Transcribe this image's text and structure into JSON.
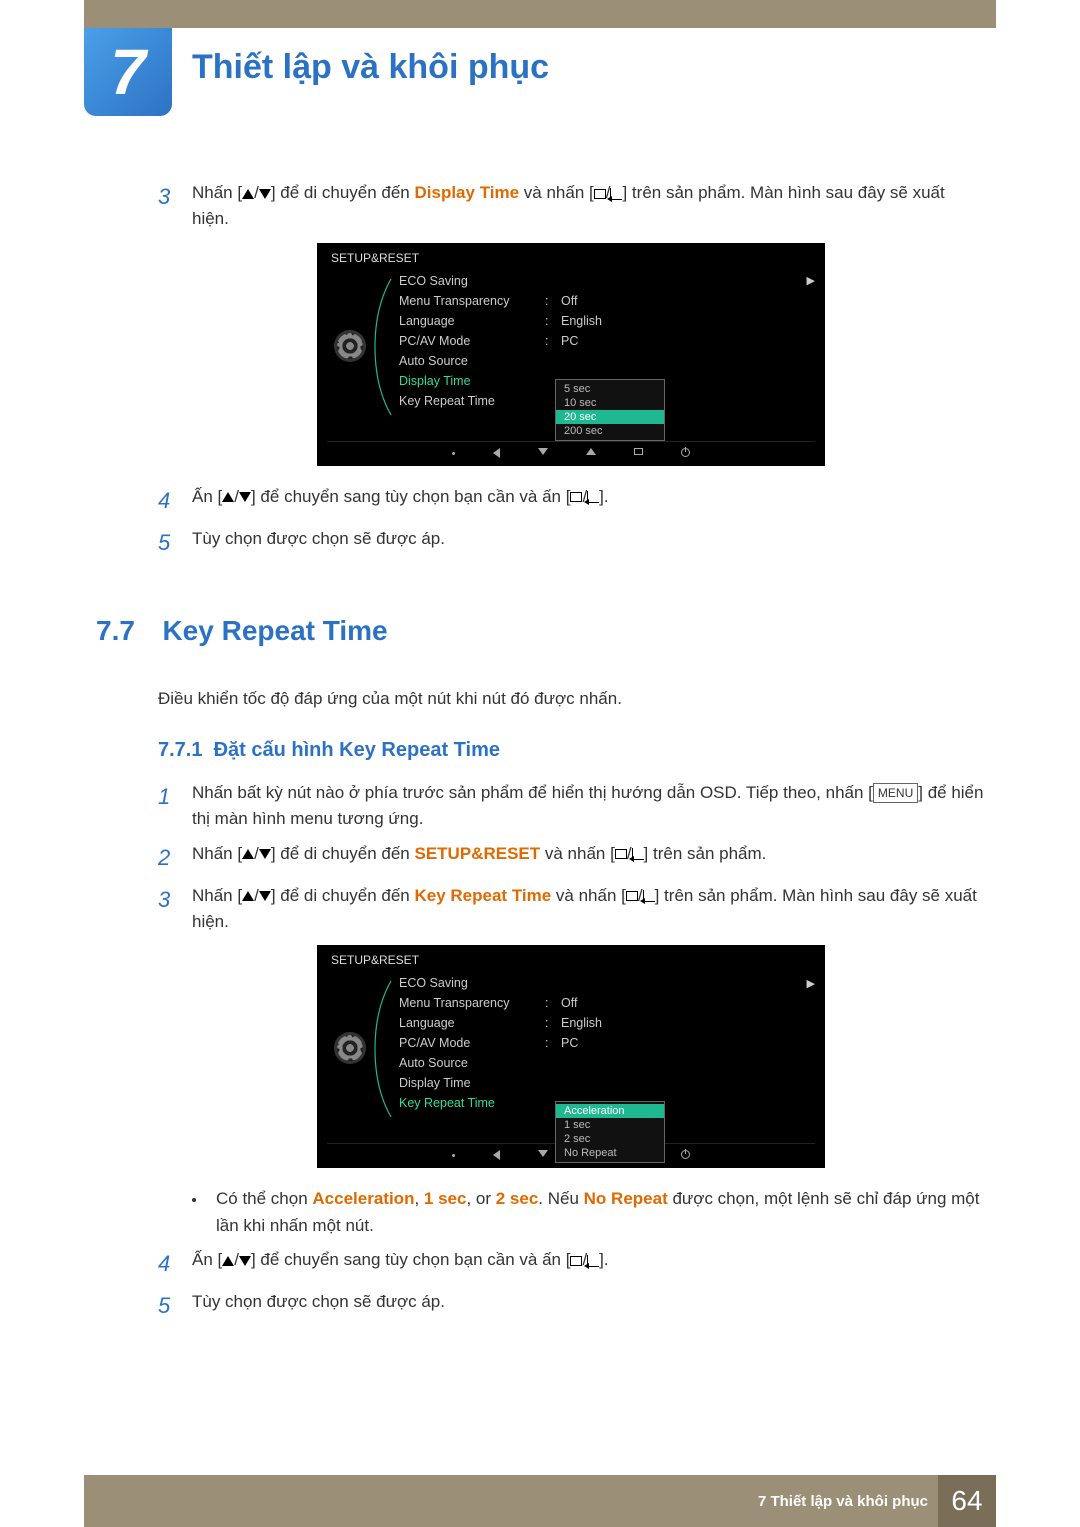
{
  "chapter": {
    "number": "7",
    "title": "Thiết lập và khôi phục"
  },
  "step3": {
    "num": "3",
    "pre": "Nhấn [",
    "mid1": "] để di chuyển đến ",
    "highlight": "Display Time",
    "mid2": " và nhấn [",
    "post": "] trên sản phẩm. Màn hình sau đây sẽ xuất hiện."
  },
  "osd1": {
    "title": "SETUP&RESET",
    "items": [
      {
        "label": "ECO Saving",
        "val": ""
      },
      {
        "label": "Menu Transparency",
        "val": "Off"
      },
      {
        "label": "Language",
        "val": "English"
      },
      {
        "label": "PC/AV Mode",
        "val": "PC"
      },
      {
        "label": "Auto Source",
        "val": ""
      },
      {
        "label": "Display Time",
        "val": "",
        "active": true
      },
      {
        "label": "Key Repeat Time",
        "val": ""
      }
    ],
    "popup": {
      "at": 5,
      "options": [
        {
          "t": "5 sec"
        },
        {
          "t": "10 sec"
        },
        {
          "t": "20 sec",
          "sel": true
        },
        {
          "t": "200 sec"
        }
      ]
    }
  },
  "step4": {
    "num": "4",
    "pre": "Ấn [",
    "mid": "] để chuyển sang tùy chọn bạn cần và ấn [",
    "post": "]."
  },
  "step5": {
    "num": "5",
    "text": "Tùy chọn được chọn sẽ được áp."
  },
  "section77": {
    "num": "7.7",
    "title": "Key Repeat Time",
    "desc": "Điều khiển tốc độ đáp ứng của một nút khi nút đó được nhấn.",
    "sub_num": "7.7.1",
    "sub_title": "Đặt cấu hình Key Repeat Time"
  },
  "s77_step1": {
    "num": "1",
    "pre": "Nhấn bất kỳ nút nào ở phía trước sản phẩm để hiển thị hướng dẫn OSD. Tiếp theo, nhấn [",
    "menu": "MENU",
    "post": "] để hiển thị màn hình menu tương ứng."
  },
  "s77_step2": {
    "num": "2",
    "pre": "Nhấn [",
    "mid1": "] để di chuyển đến ",
    "highlight": "SETUP&RESET",
    "mid2": " và nhấn [",
    "post": "] trên sản phẩm."
  },
  "s77_step3": {
    "num": "3",
    "pre": "Nhấn [",
    "mid1": "] để di chuyển đến ",
    "highlight": "Key Repeat Time",
    "mid2": " và nhấn [",
    "post": "] trên sản phẩm. Màn hình sau đây sẽ xuất hiện."
  },
  "osd2": {
    "title": "SETUP&RESET",
    "items": [
      {
        "label": "ECO Saving",
        "val": ""
      },
      {
        "label": "Menu Transparency",
        "val": "Off"
      },
      {
        "label": "Language",
        "val": "English"
      },
      {
        "label": "PC/AV Mode",
        "val": "PC"
      },
      {
        "label": "Auto Source",
        "val": ""
      },
      {
        "label": "Display Time",
        "val": ""
      },
      {
        "label": "Key Repeat Time",
        "val": "",
        "active": true
      }
    ],
    "popup": {
      "at": 6,
      "options": [
        {
          "t": "Acceleration",
          "sel": true
        },
        {
          "t": "1 sec"
        },
        {
          "t": "2 sec"
        },
        {
          "t": "No Repeat"
        }
      ]
    }
  },
  "s77_bullet": {
    "pre": "Có thể chọn ",
    "h1": "Acceleration",
    "c1": ", ",
    "h2": "1 sec",
    "c2": ", or ",
    "h3": "2 sec",
    "c3": ". Nếu ",
    "h4": "No Repeat",
    "post": " được chọn, một lệnh sẽ chỉ đáp ứng một lần khi nhấn một nút."
  },
  "s77_step4": {
    "num": "4",
    "pre": "Ấn [",
    "mid": "] để chuyển sang tùy chọn bạn cần và ấn [",
    "post": "]."
  },
  "s77_step5": {
    "num": "5",
    "text": "Tùy chọn được chọn sẽ được áp."
  },
  "footer": {
    "label": "7 Thiết lập và khôi phục",
    "page": "64"
  }
}
